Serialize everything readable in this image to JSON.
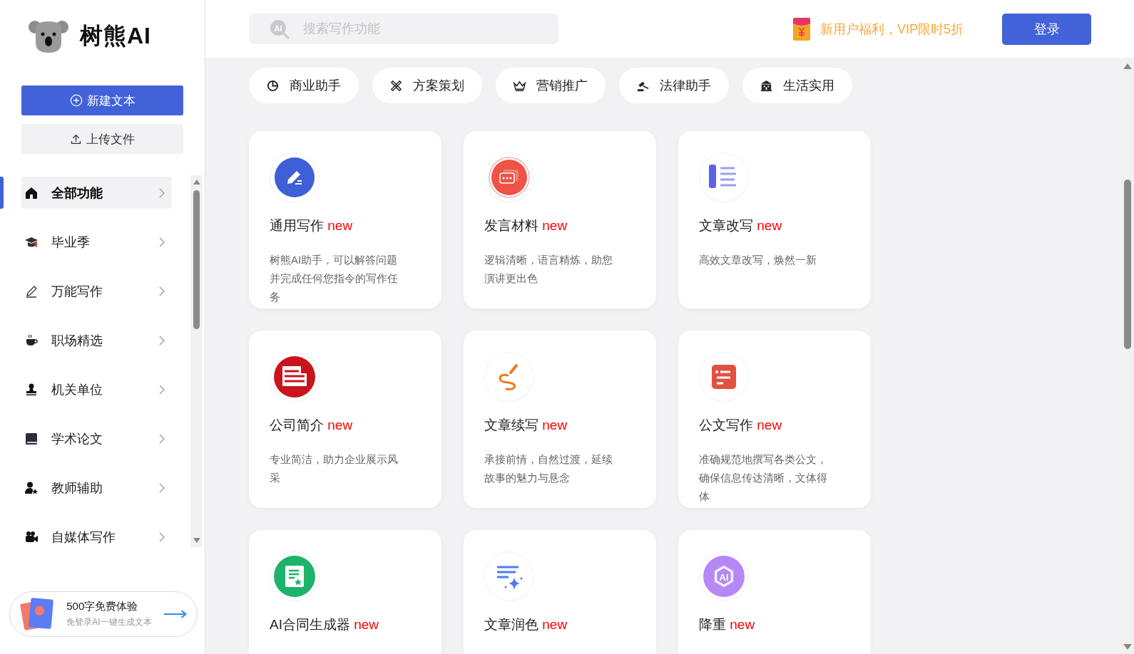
{
  "logo": {
    "text": "树熊AI"
  },
  "sidebar": {
    "actions": [
      {
        "label": "新建文本",
        "kind": "primary"
      },
      {
        "label": "上传文件",
        "kind": "secondary"
      }
    ],
    "nav": [
      {
        "label": "全部功能",
        "selected": true
      },
      {
        "label": "毕业季",
        "selected": false
      },
      {
        "label": "万能写作",
        "selected": false
      },
      {
        "label": "职场精选",
        "selected": false
      },
      {
        "label": "机关单位",
        "selected": false
      },
      {
        "label": "学术论文",
        "selected": false
      },
      {
        "label": "教师辅助",
        "selected": false
      },
      {
        "label": "自媒体写作",
        "selected": false
      }
    ],
    "promo": {
      "title": "500字免费体验",
      "subtitle": "免登录AI一键生成文本"
    }
  },
  "search": {
    "icon_text": "AI",
    "placeholder": "搜索写作功能"
  },
  "offer": {
    "text": "新用户福利，VIP限时5折"
  },
  "login_button": "登录",
  "categories": [
    "商业助手",
    "方案策划",
    "营销推广",
    "法律助手",
    "生活实用"
  ],
  "cards": [
    {
      "title": "通用写作",
      "badge": "new",
      "description": "树熊AI助手，可以解答问题并完成任何您指令的写作任务"
    },
    {
      "title": "发言材料",
      "badge": "new",
      "description": "逻辑清晰，语言精炼，助您演讲更出色"
    },
    {
      "title": "文章改写",
      "badge": "new",
      "description": "高效文章改写，焕然一新"
    },
    {
      "title": "公司简介",
      "badge": "new",
      "description": "专业简洁，助力企业展示风采"
    },
    {
      "title": "文章续写",
      "badge": "new",
      "description": "承接前情，自然过渡，延续故事的魅力与悬念"
    },
    {
      "title": "公文写作",
      "badge": "new",
      "description": "准确规范地撰写各类公文，确保信息传达清晰，文体得体"
    },
    {
      "title": "AI合同生成器",
      "badge": "new"
    },
    {
      "title": "文章润色",
      "badge": "new"
    },
    {
      "title": "降重",
      "badge": "new"
    }
  ],
  "hexagon_icon_text": "AI"
}
